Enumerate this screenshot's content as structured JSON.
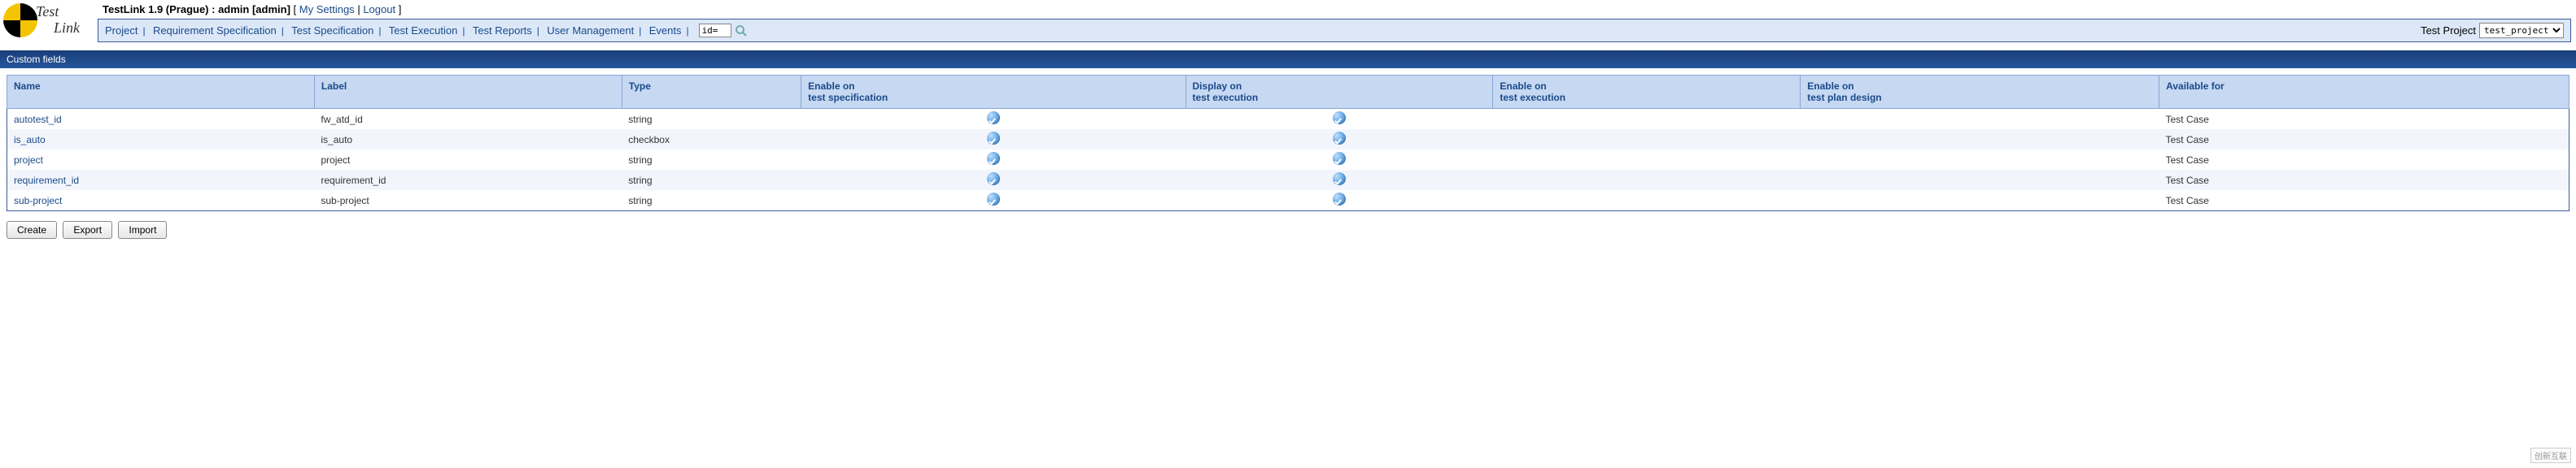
{
  "header": {
    "app_title": "TestLink 1.9 (Prague) : admin [admin]",
    "my_settings": "My Settings",
    "logout": "Logout",
    "logo_top": "Test",
    "logo_bottom": "Link"
  },
  "nav": {
    "items": [
      "Project",
      "Requirement Specification",
      "Test Specification",
      "Test Execution",
      "Test Reports",
      "User Management",
      "Events"
    ],
    "search_value": "id=",
    "project_label": "Test Project",
    "project_selected": "test_project"
  },
  "section": {
    "title": "Custom fields"
  },
  "table": {
    "headers": {
      "name": "Name",
      "label": "Label",
      "type": "Type",
      "enable_spec": "Enable on\ntest specification",
      "display_exec": "Display on\ntest execution",
      "enable_exec": "Enable on\ntest execution",
      "enable_plan": "Enable on\ntest plan design",
      "available_for": "Available for"
    },
    "rows": [
      {
        "name": "autotest_id",
        "label": "fw_atd_id",
        "type": "string",
        "enable_spec": true,
        "display_exec": true,
        "enable_exec": false,
        "enable_plan": false,
        "available_for": "Test Case"
      },
      {
        "name": "is_auto",
        "label": "is_auto",
        "type": "checkbox",
        "enable_spec": true,
        "display_exec": true,
        "enable_exec": false,
        "enable_plan": false,
        "available_for": "Test Case"
      },
      {
        "name": "project",
        "label": "project",
        "type": "string",
        "enable_spec": true,
        "display_exec": true,
        "enable_exec": false,
        "enable_plan": false,
        "available_for": "Test Case"
      },
      {
        "name": "requirement_id",
        "label": "requirement_id",
        "type": "string",
        "enable_spec": true,
        "display_exec": true,
        "enable_exec": false,
        "enable_plan": false,
        "available_for": "Test Case"
      },
      {
        "name": "sub-project",
        "label": "sub-project",
        "type": "string",
        "enable_spec": true,
        "display_exec": true,
        "enable_exec": false,
        "enable_plan": false,
        "available_for": "Test Case"
      }
    ]
  },
  "buttons": {
    "create": "Create",
    "export": "Export",
    "import": "Import"
  },
  "watermark": "创新互联"
}
